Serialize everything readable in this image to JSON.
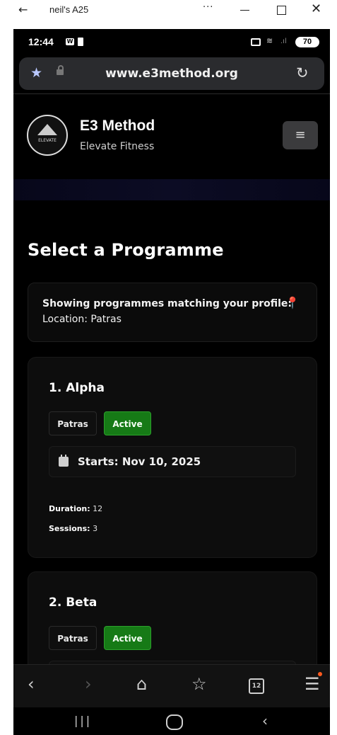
{
  "window": {
    "back_glyph": "←",
    "title": "neil's A25",
    "more_glyph": "···",
    "close_glyph": "✕"
  },
  "status_bar": {
    "time": "12:44",
    "battery": "70",
    "icons": [
      "outlook-icon",
      "phone-icon",
      "cast-icon",
      "wifi-icon",
      "signal-icon",
      "battery-icon"
    ]
  },
  "browser": {
    "url": "www.e3method.org",
    "star_glyph": "★",
    "reload_glyph": "↻"
  },
  "site": {
    "brand_title": "E3 Method",
    "brand_subtitle": "Elevate Fitness",
    "logo_text": "ELEVATE",
    "menu_glyph": "≡"
  },
  "page": {
    "title": "Select a Programme",
    "info_line1": "Showing programmes matching your profile:",
    "info_line2": "Location: Patras",
    "pin_glyph": "📍"
  },
  "programmes": [
    {
      "title": "1. Alpha",
      "location": "Patras",
      "status": "Active",
      "starts": "Starts: Nov 10, 2025",
      "duration_label": "Duration:",
      "duration_value": "12",
      "sessions_label": "Sessions:",
      "sessions_value": "3"
    },
    {
      "title": "2. Beta",
      "location": "Patras",
      "status": "Active"
    }
  ],
  "bottom_nav": {
    "back": "‹",
    "forward": "›",
    "home": "⌂",
    "favorites": "☆",
    "tabs_count": "12",
    "menu": "☰"
  },
  "android_nav": {
    "recent": "|||",
    "back": "‹"
  },
  "colors": {
    "active_tag": "#167a16",
    "url_bar": "#2a2b2e",
    "background": "#000000",
    "notification_dot": "#ff5a1f"
  }
}
